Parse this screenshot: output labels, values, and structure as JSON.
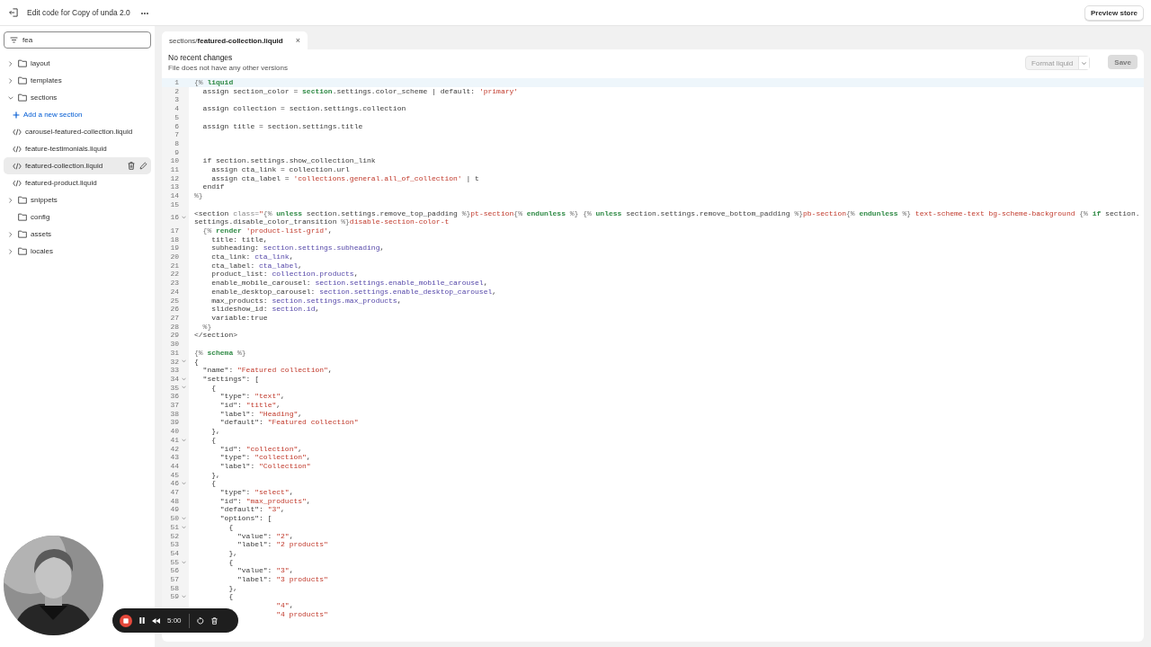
{
  "header": {
    "title": "Edit code for Copy of unda 2.0",
    "more": "•••",
    "preview_button": "Preview store"
  },
  "sidebar": {
    "search": {
      "value": "fea"
    },
    "tree": [
      {
        "kind": "folder",
        "label": "layout",
        "expandable": true,
        "expanded": false
      },
      {
        "kind": "folder",
        "label": "templates",
        "expandable": true,
        "expanded": false
      },
      {
        "kind": "folder",
        "label": "sections",
        "expandable": true,
        "expanded": true,
        "children": [
          {
            "kind": "action",
            "label": "Add a new section"
          },
          {
            "kind": "file",
            "label": "carousel-featured-collection.liquid",
            "selected": false
          },
          {
            "kind": "file",
            "label": "feature-testimonials.liquid",
            "selected": false
          },
          {
            "kind": "file",
            "label": "featured-collection.liquid",
            "selected": true
          },
          {
            "kind": "file",
            "label": "featured-product.liquid",
            "selected": false
          }
        ]
      },
      {
        "kind": "folder",
        "label": "snippets",
        "expandable": true,
        "expanded": false
      },
      {
        "kind": "folder",
        "label": "config",
        "expandable": false
      },
      {
        "kind": "folder",
        "label": "assets",
        "expandable": true,
        "expanded": false
      },
      {
        "kind": "folder",
        "label": "locales",
        "expandable": true,
        "expanded": false
      }
    ]
  },
  "editor": {
    "tabs": [
      {
        "label": "sections/**featured-collection.liquid**",
        "close": "×",
        "selected": true
      }
    ],
    "status": {
      "title": "No recent changes",
      "subtitle": "File does not have any other versions"
    },
    "format_button": {
      "label": "Format liquid",
      "disabled": true
    },
    "save_button": {
      "label": "Save",
      "disabled": true
    },
    "lines": [
      {
        "number": "1",
        "active": true,
        "foldable": false,
        "tokens": [
          {
            "kind": "delimiter",
            "text": "{% "
          },
          {
            "kind": "keyword",
            "text": "liquid"
          }
        ]
      },
      {
        "number": "2",
        "active": false,
        "foldable": false,
        "tokens": [
          {
            "kind": "plain",
            "text": "  assign section_color = "
          },
          {
            "kind": "keyword",
            "text": "section"
          },
          {
            "kind": "plain",
            "text": ".settings.color_scheme | default: "
          },
          {
            "kind": "string",
            "text": "'primary'"
          }
        ]
      },
      {
        "number": "3",
        "active": false,
        "foldable": false
      },
      {
        "number": "4",
        "active": false,
        "foldable": false,
        "tokens": [
          {
            "kind": "plain",
            "text": "  assign collection = section.settings.collection"
          }
        ]
      },
      {
        "number": "5",
        "active": false,
        "foldable": false
      },
      {
        "number": "6",
        "active": false,
        "foldable": false,
        "tokens": [
          {
            "kind": "plain",
            "text": "  assign title = section.settings.title"
          }
        ]
      },
      {
        "number": "7",
        "active": false,
        "foldable": false
      },
      {
        "number": "8",
        "active": false,
        "foldable": false
      },
      {
        "number": "9",
        "active": false,
        "foldable": false
      },
      {
        "number": "10",
        "active": false,
        "foldable": false,
        "tokens": [
          {
            "kind": "plain",
            "text": "  if section.settings.show_collection_link"
          }
        ]
      },
      {
        "number": "11",
        "active": false,
        "foldable": false,
        "tokens": [
          {
            "kind": "plain",
            "text": "    assign cta_link = collection.url"
          }
        ]
      },
      {
        "number": "12",
        "active": false,
        "foldable": false,
        "tokens": [
          {
            "kind": "plain",
            "text": "    assign cta_label = "
          },
          {
            "kind": "string",
            "text": "'collections.general.all_of_collection'"
          },
          {
            "kind": "plain",
            "text": " | t"
          }
        ]
      },
      {
        "number": "13",
        "active": false,
        "foldable": false,
        "tokens": [
          {
            "kind": "plain",
            "text": "  endif"
          }
        ]
      },
      {
        "number": "14",
        "active": false,
        "foldable": false,
        "tokens": [
          {
            "kind": "delimiter",
            "text": "%}"
          }
        ]
      },
      {
        "number": "15",
        "active": false,
        "foldable": false
      },
      {
        "number": "16",
        "active": false,
        "foldable": true,
        "tokens": [
          {
            "kind": "plain",
            "text": "<section "
          },
          {
            "kind": "attribute",
            "text": "class="
          },
          {
            "kind": "string",
            "text": "\""
          },
          {
            "kind": "delimiter",
            "text": "{% "
          },
          {
            "kind": "keyword",
            "text": "unless"
          },
          {
            "kind": "plain",
            "text": " section.settings.remove_top_padding "
          },
          {
            "kind": "delimiter",
            "text": "%}"
          },
          {
            "kind": "string",
            "text": "pt-section"
          },
          {
            "kind": "delimiter",
            "text": "{% "
          },
          {
            "kind": "keyword",
            "text": "endunless"
          },
          {
            "kind": "delimiter",
            "text": " %} {% "
          },
          {
            "kind": "keyword",
            "text": "unless"
          },
          {
            "kind": "plain",
            "text": " section.settings.remove_bottom_padding "
          },
          {
            "kind": "delimiter",
            "text": "%}"
          },
          {
            "kind": "string",
            "text": "pb-section"
          },
          {
            "kind": "delimiter",
            "text": "{% "
          },
          {
            "kind": "keyword",
            "text": "endunless"
          },
          {
            "kind": "delimiter",
            "text": " %}"
          },
          {
            "kind": "string",
            "text": " text-scheme-text bg-scheme-background "
          },
          {
            "kind": "delimiter",
            "text": "{% "
          },
          {
            "kind": "keyword",
            "text": "if"
          },
          {
            "kind": "plain",
            "text": " section.settings.disable_color_transition "
          },
          {
            "kind": "delimiter",
            "text": "%}"
          },
          {
            "kind": "string",
            "text": "disable-section-color-t"
          }
        ]
      },
      {
        "number": "17",
        "active": false,
        "foldable": false,
        "tokens": [
          {
            "kind": "delimiter",
            "text": "  {% "
          },
          {
            "kind": "keyword",
            "text": "render"
          },
          {
            "kind": "string",
            "text": " 'product-list-grid'"
          },
          {
            "kind": "plain",
            "text": ","
          }
        ]
      },
      {
        "number": "18",
        "active": false,
        "foldable": false,
        "tokens": [
          {
            "kind": "plain",
            "text": "    title: title,"
          }
        ]
      },
      {
        "number": "19",
        "active": false,
        "foldable": false,
        "tokens": [
          {
            "kind": "plain",
            "text": "    subheading: "
          },
          {
            "kind": "variable",
            "text": "section.settings.subheading"
          },
          {
            "kind": "plain",
            "text": ","
          }
        ]
      },
      {
        "number": "20",
        "active": false,
        "foldable": false,
        "tokens": [
          {
            "kind": "plain",
            "text": "    cta_link: "
          },
          {
            "kind": "variable",
            "text": "cta_link"
          },
          {
            "kind": "plain",
            "text": ","
          }
        ]
      },
      {
        "number": "21",
        "active": false,
        "foldable": false,
        "tokens": [
          {
            "kind": "plain",
            "text": "    cta_label: "
          },
          {
            "kind": "variable",
            "text": "cta_label"
          },
          {
            "kind": "plain",
            "text": ","
          }
        ]
      },
      {
        "number": "22",
        "active": false,
        "foldable": false,
        "tokens": [
          {
            "kind": "plain",
            "text": "    product_list: "
          },
          {
            "kind": "variable",
            "text": "collection.products"
          },
          {
            "kind": "plain",
            "text": ","
          }
        ]
      },
      {
        "number": "23",
        "active": false,
        "foldable": false,
        "tokens": [
          {
            "kind": "plain",
            "text": "    enable_mobile_carousel: "
          },
          {
            "kind": "variable",
            "text": "section.settings.enable_mobile_carousel"
          },
          {
            "kind": "plain",
            "text": ","
          }
        ]
      },
      {
        "number": "24",
        "active": false,
        "foldable": false,
        "tokens": [
          {
            "kind": "plain",
            "text": "    enable_desktop_carousel: "
          },
          {
            "kind": "variable",
            "text": "section.settings.enable_desktop_carousel"
          },
          {
            "kind": "plain",
            "text": ","
          }
        ]
      },
      {
        "number": "25",
        "active": false,
        "foldable": false,
        "tokens": [
          {
            "kind": "plain",
            "text": "    max_products: "
          },
          {
            "kind": "variable",
            "text": "section.settings.max_products"
          },
          {
            "kind": "plain",
            "text": ","
          }
        ]
      },
      {
        "number": "26",
        "active": false,
        "foldable": false,
        "tokens": [
          {
            "kind": "plain",
            "text": "    slideshow_id: "
          },
          {
            "kind": "variable",
            "text": "section.id"
          },
          {
            "kind": "plain",
            "text": ","
          }
        ]
      },
      {
        "number": "27",
        "active": false,
        "foldable": false,
        "tokens": [
          {
            "kind": "plain",
            "text": "    variable:true"
          }
        ]
      },
      {
        "number": "28",
        "active": false,
        "foldable": false,
        "tokens": [
          {
            "kind": "delimiter",
            "text": "  %}"
          }
        ]
      },
      {
        "number": "29",
        "active": false,
        "foldable": false,
        "tokens": [
          {
            "kind": "plain",
            "text": "</section>"
          }
        ]
      },
      {
        "number": "30",
        "active": false,
        "foldable": false
      },
      {
        "number": "31",
        "active": false,
        "foldable": false,
        "tokens": [
          {
            "kind": "delimiter",
            "text": "{% "
          },
          {
            "kind": "keyword",
            "text": "schema"
          },
          {
            "kind": "delimiter",
            "text": " %}"
          }
        ]
      },
      {
        "number": "32",
        "active": false,
        "foldable": true,
        "tokens": [
          {
            "kind": "plain",
            "text": "{"
          }
        ]
      },
      {
        "number": "33",
        "active": false,
        "foldable": false,
        "tokens": [
          {
            "kind": "plain",
            "text": "  \"name\": "
          },
          {
            "kind": "string",
            "text": "\"Featured collection\""
          },
          {
            "kind": "plain",
            "text": ","
          }
        ]
      },
      {
        "number": "34",
        "active": false,
        "foldable": true,
        "tokens": [
          {
            "kind": "plain",
            "text": "  \"settings\": ["
          }
        ]
      },
      {
        "number": "35",
        "active": false,
        "foldable": true,
        "tokens": [
          {
            "kind": "plain",
            "text": "    {"
          }
        ]
      },
      {
        "number": "36",
        "active": false,
        "foldable": false,
        "tokens": [
          {
            "kind": "plain",
            "text": "      \"type\": "
          },
          {
            "kind": "string",
            "text": "\"text\""
          },
          {
            "kind": "plain",
            "text": ","
          }
        ]
      },
      {
        "number": "37",
        "active": false,
        "foldable": false,
        "tokens": [
          {
            "kind": "plain",
            "text": "      \"id\": "
          },
          {
            "kind": "string",
            "text": "\"title\""
          },
          {
            "kind": "plain",
            "text": ","
          }
        ]
      },
      {
        "number": "38",
        "active": false,
        "foldable": false,
        "tokens": [
          {
            "kind": "plain",
            "text": "      \"label\": "
          },
          {
            "kind": "string",
            "text": "\"Heading\""
          },
          {
            "kind": "plain",
            "text": ","
          }
        ]
      },
      {
        "number": "39",
        "active": false,
        "foldable": false,
        "tokens": [
          {
            "kind": "plain",
            "text": "      \"default\": "
          },
          {
            "kind": "string",
            "text": "\"Featured collection\""
          }
        ]
      },
      {
        "number": "40",
        "active": false,
        "foldable": false,
        "tokens": [
          {
            "kind": "plain",
            "text": "    },"
          }
        ]
      },
      {
        "number": "41",
        "active": false,
        "foldable": true,
        "tokens": [
          {
            "kind": "plain",
            "text": "    {"
          }
        ]
      },
      {
        "number": "42",
        "active": false,
        "foldable": false,
        "tokens": [
          {
            "kind": "plain",
            "text": "      \"id\": "
          },
          {
            "kind": "string",
            "text": "\"collection\""
          },
          {
            "kind": "plain",
            "text": ","
          }
        ]
      },
      {
        "number": "43",
        "active": false,
        "foldable": false,
        "tokens": [
          {
            "kind": "plain",
            "text": "      \"type\": "
          },
          {
            "kind": "string",
            "text": "\"collection\""
          },
          {
            "kind": "plain",
            "text": ","
          }
        ]
      },
      {
        "number": "44",
        "active": false,
        "foldable": false,
        "tokens": [
          {
            "kind": "plain",
            "text": "      \"label\": "
          },
          {
            "kind": "string",
            "text": "\"Collection\""
          }
        ]
      },
      {
        "number": "45",
        "active": false,
        "foldable": false,
        "tokens": [
          {
            "kind": "plain",
            "text": "    },"
          }
        ]
      },
      {
        "number": "46",
        "active": false,
        "foldable": true,
        "tokens": [
          {
            "kind": "plain",
            "text": "    {"
          }
        ]
      },
      {
        "number": "47",
        "active": false,
        "foldable": false,
        "tokens": [
          {
            "kind": "plain",
            "text": "      \"type\": "
          },
          {
            "kind": "string",
            "text": "\"select\""
          },
          {
            "kind": "plain",
            "text": ","
          }
        ]
      },
      {
        "number": "48",
        "active": false,
        "foldable": false,
        "tokens": [
          {
            "kind": "plain",
            "text": "      \"id\": "
          },
          {
            "kind": "string",
            "text": "\"max_products\""
          },
          {
            "kind": "plain",
            "text": ","
          }
        ]
      },
      {
        "number": "49",
        "active": false,
        "foldable": false,
        "tokens": [
          {
            "kind": "plain",
            "text": "      \"default\": "
          },
          {
            "kind": "string",
            "text": "\"3\""
          },
          {
            "kind": "plain",
            "text": ","
          }
        ]
      },
      {
        "number": "50",
        "active": false,
        "foldable": true,
        "tokens": [
          {
            "kind": "plain",
            "text": "      \"options\": ["
          }
        ]
      },
      {
        "number": "51",
        "active": false,
        "foldable": true,
        "tokens": [
          {
            "kind": "plain",
            "text": "        {"
          }
        ]
      },
      {
        "number": "52",
        "active": false,
        "foldable": false,
        "tokens": [
          {
            "kind": "plain",
            "text": "          \"value\": "
          },
          {
            "kind": "string",
            "text": "\"2\""
          },
          {
            "kind": "plain",
            "text": ","
          }
        ]
      },
      {
        "number": "53",
        "active": false,
        "foldable": false,
        "tokens": [
          {
            "kind": "plain",
            "text": "          \"label\": "
          },
          {
            "kind": "string",
            "text": "\"2 products\""
          }
        ]
      },
      {
        "number": "54",
        "active": false,
        "foldable": false,
        "tokens": [
          {
            "kind": "plain",
            "text": "        },"
          }
        ]
      },
      {
        "number": "55",
        "active": false,
        "foldable": true,
        "tokens": [
          {
            "kind": "plain",
            "text": "        {"
          }
        ]
      },
      {
        "number": "56",
        "active": false,
        "foldable": false,
        "tokens": [
          {
            "kind": "plain",
            "text": "          \"value\": "
          },
          {
            "kind": "string",
            "text": "\"3\""
          },
          {
            "kind": "plain",
            "text": ","
          }
        ]
      },
      {
        "number": "57",
        "active": false,
        "foldable": false,
        "tokens": [
          {
            "kind": "plain",
            "text": "          \"label\": "
          },
          {
            "kind": "string",
            "text": "\"3 products\""
          }
        ]
      },
      {
        "number": "58",
        "active": false,
        "foldable": false,
        "tokens": [
          {
            "kind": "plain",
            "text": "        },"
          }
        ]
      },
      {
        "number": "59",
        "active": false,
        "foldable": true,
        "tokens": [
          {
            "kind": "plain",
            "text": "        {"
          }
        ]
      },
      {
        "tokens": [
          {
            "kind": "string",
            "text": "                   \"4\""
          },
          {
            "kind": "plain",
            "text": ","
          }
        ]
      },
      {
        "tokens": [
          {
            "kind": "string",
            "text": "                   \"4 products\""
          }
        ]
      }
    ]
  },
  "recorder": {
    "timer": "5:00"
  }
}
